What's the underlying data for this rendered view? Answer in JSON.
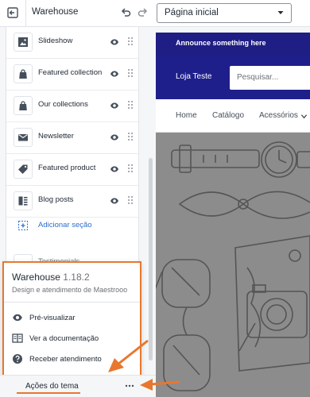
{
  "topbar": {
    "exit_icon": "exit-icon",
    "store_name": "Warehouse",
    "undo_icon": "undo-icon",
    "redo_icon": "redo-icon",
    "page_select_value": "Página inicial"
  },
  "sidebar": {
    "sections": [
      {
        "label": "Slideshow",
        "icon": "image-icon"
      },
      {
        "label": "Featured collection",
        "icon": "bag-icon"
      },
      {
        "label": "Our collections",
        "icon": "bag-icon"
      },
      {
        "label": "Newsletter",
        "icon": "envelope-icon"
      },
      {
        "label": "Featured product",
        "icon": "tag-icon"
      },
      {
        "label": "Blog posts",
        "icon": "blog-icon"
      }
    ],
    "add_section_label": "Adicionar seção",
    "partial_label": "Testimonials"
  },
  "theme_popover": {
    "name": "Warehouse",
    "version": "1.18.2",
    "developer": "Design e atendimento de Maestrooo",
    "actions": [
      {
        "label": "Pré-visualizar",
        "icon": "eye-icon"
      },
      {
        "label": "Ver a documentação",
        "icon": "book-icon"
      },
      {
        "label": "Receber atendimento",
        "icon": "help-icon"
      }
    ]
  },
  "footer": {
    "label": "Ações do tema",
    "more_icon": "more-icon"
  },
  "preview": {
    "announcement": "Announce something here",
    "store_logo": "Loja Teste",
    "search_placeholder": "Pesquisar...",
    "nav": [
      "Home",
      "Catálogo",
      "Acessórios"
    ]
  },
  "colors": {
    "accent": "#e8772e",
    "brand_navy": "#1f1f8c",
    "link_blue": "#2c6ecb",
    "hero_gray": "#8c8c8c"
  }
}
